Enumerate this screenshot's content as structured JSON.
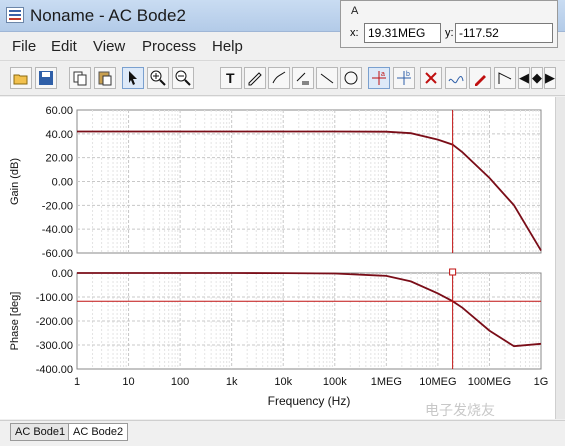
{
  "window": {
    "title": "Noname - AC Bode2"
  },
  "menu": [
    "File",
    "Edit",
    "View",
    "Process",
    "Help"
  ],
  "cursor_box": {
    "label": "A",
    "x_label": "x:",
    "x_value": "19.31MEG",
    "y_label": "y:",
    "y_value": "-117.52"
  },
  "toolbar": {
    "items": [
      "open-icon",
      "save-icon",
      "copy-icon",
      "paste-icon",
      "select-icon",
      "zoom-in-icon",
      "zoom-out-icon",
      "text-icon",
      "pencil-line-icon",
      "pencil-curve-icon",
      "pencil-list-icon",
      "line-icon",
      "ellipse-icon",
      "cursor-a-icon",
      "cursor-b-icon",
      "cross-cursor-icon",
      "wave-cursor-icon",
      "pen-cursor-icon",
      "angle-icon",
      "arrow-left-icon",
      "arrow-updown-icon",
      "arrow-right-icon"
    ]
  },
  "colors": {
    "curve": "#7a0d18",
    "cursor": "#c01010",
    "grid": "#c8c8c8"
  },
  "chart_data": [
    {
      "type": "line",
      "ylabel": "Gain (dB)",
      "x_scale": "log",
      "xlim": [
        1,
        1000000000
      ],
      "ylim": [
        -60,
        60
      ],
      "yticks": [
        "60.00",
        "40.00",
        "20.00",
        "0.00",
        "-20.00",
        "-40.00",
        "-60.00"
      ],
      "x": [
        1,
        10,
        100,
        1000,
        10000,
        100000,
        1000000,
        3000000,
        10000000,
        19310000,
        30000000,
        100000000,
        300000000,
        1000000000
      ],
      "y": [
        42,
        42,
        42,
        42,
        42,
        42,
        41.8,
        40.5,
        35.2,
        31,
        24.5,
        3,
        -20,
        -58
      ]
    },
    {
      "type": "line",
      "ylabel": "Phase [deg]",
      "xlabel": "Frequency (Hz)",
      "x_scale": "log",
      "xlim": [
        1,
        1000000000
      ],
      "ylim": [
        -400,
        0
      ],
      "yticks": [
        "0.00",
        "-100.00",
        "-200.00",
        "-300.00",
        "-400.00"
      ],
      "xticks": [
        "1",
        "10",
        "100",
        "1k",
        "10k",
        "100k",
        "1MEG",
        "10MEG",
        "100MEG",
        "1G"
      ],
      "x": [
        1,
        10,
        100,
        1000,
        10000,
        100000,
        1000000,
        3000000,
        10000000,
        19310000,
        30000000,
        100000000,
        300000000,
        1000000000
      ],
      "y": [
        0,
        0,
        0,
        0,
        -0.5,
        -2,
        -12,
        -35,
        -85,
        -117.52,
        -145,
        -240,
        -305,
        -295
      ],
      "cursor": {
        "x": 19310000,
        "y": -117.52
      }
    }
  ],
  "tabs": [
    "AC Bode1",
    "AC Bode2"
  ],
  "watermark": "电子发烧友"
}
